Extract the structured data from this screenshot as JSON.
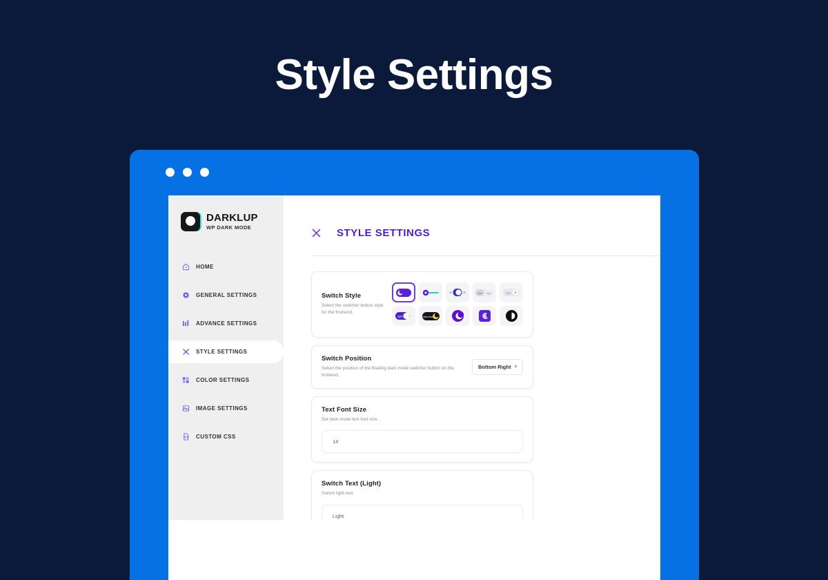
{
  "hero": {
    "title": "Style Settings"
  },
  "browser": {
    "dots": [
      "dot-red",
      "dot-yellow",
      "dot-green"
    ]
  },
  "app": {
    "brand": {
      "name": "DARKLUP",
      "subtitle": "WP DARK MODE",
      "logo_icon": "moon-icon"
    },
    "sidebar": {
      "items": [
        {
          "label": "HOME",
          "icon": "home-icon",
          "active": false
        },
        {
          "label": "GENERAL SETTINGS",
          "icon": "gear-icon",
          "active": false
        },
        {
          "label": "ADVANCE SETTINGS",
          "icon": "sliders-icon",
          "active": false
        },
        {
          "label": "STYLE SETTINGS",
          "icon": "tools-icon",
          "active": true
        },
        {
          "label": "COLOR SETTINGS",
          "icon": "palette-icon",
          "active": false
        },
        {
          "label": "IMAGE SETTINGS",
          "icon": "image-icon",
          "active": false
        },
        {
          "label": "CUSTOM CSS",
          "icon": "code-file-icon",
          "active": false
        }
      ]
    },
    "header": {
      "title": "STYLE SETTINGS",
      "icon": "tools-icon"
    },
    "cards": {
      "switch_style": {
        "title": "Switch Style",
        "desc": "Select the switcher button style for the frontend.",
        "options": [
          {
            "name": "toggle-purple-moon",
            "selected": true
          },
          {
            "name": "slider-line-cyan",
            "selected": false
          },
          {
            "name": "toggle-sun-moon-labels",
            "selected": false
          },
          {
            "name": "pill-dark-light-text",
            "selected": false
          },
          {
            "name": "pill-light-text-knob",
            "selected": false
          },
          {
            "name": "toggle-light-purple",
            "selected": false
          },
          {
            "name": "pill-black-yellow-moon",
            "selected": false
          },
          {
            "name": "circle-purple-moon",
            "selected": false
          },
          {
            "name": "square-purple-moon",
            "selected": false
          },
          {
            "name": "circle-black-contrast",
            "selected": false
          }
        ]
      },
      "switch_position": {
        "title": "Switch Position",
        "desc": "Select the position of the floating dark mode switcher button on the frontend.",
        "select_value": "Bottom Right"
      },
      "text_font_size": {
        "title": "Text Font Size",
        "desc": "Set dark mode text font size.",
        "value": "14"
      },
      "switch_text_light": {
        "title": "Switch Text (Light)",
        "desc": "Switch light text.",
        "value": "Light"
      }
    }
  },
  "colors": {
    "page_bg": "#0b1a3a",
    "frame_blue": "#0671e4",
    "accent_purple": "#4b1fd6",
    "sidebar_bg": "#efefef"
  }
}
